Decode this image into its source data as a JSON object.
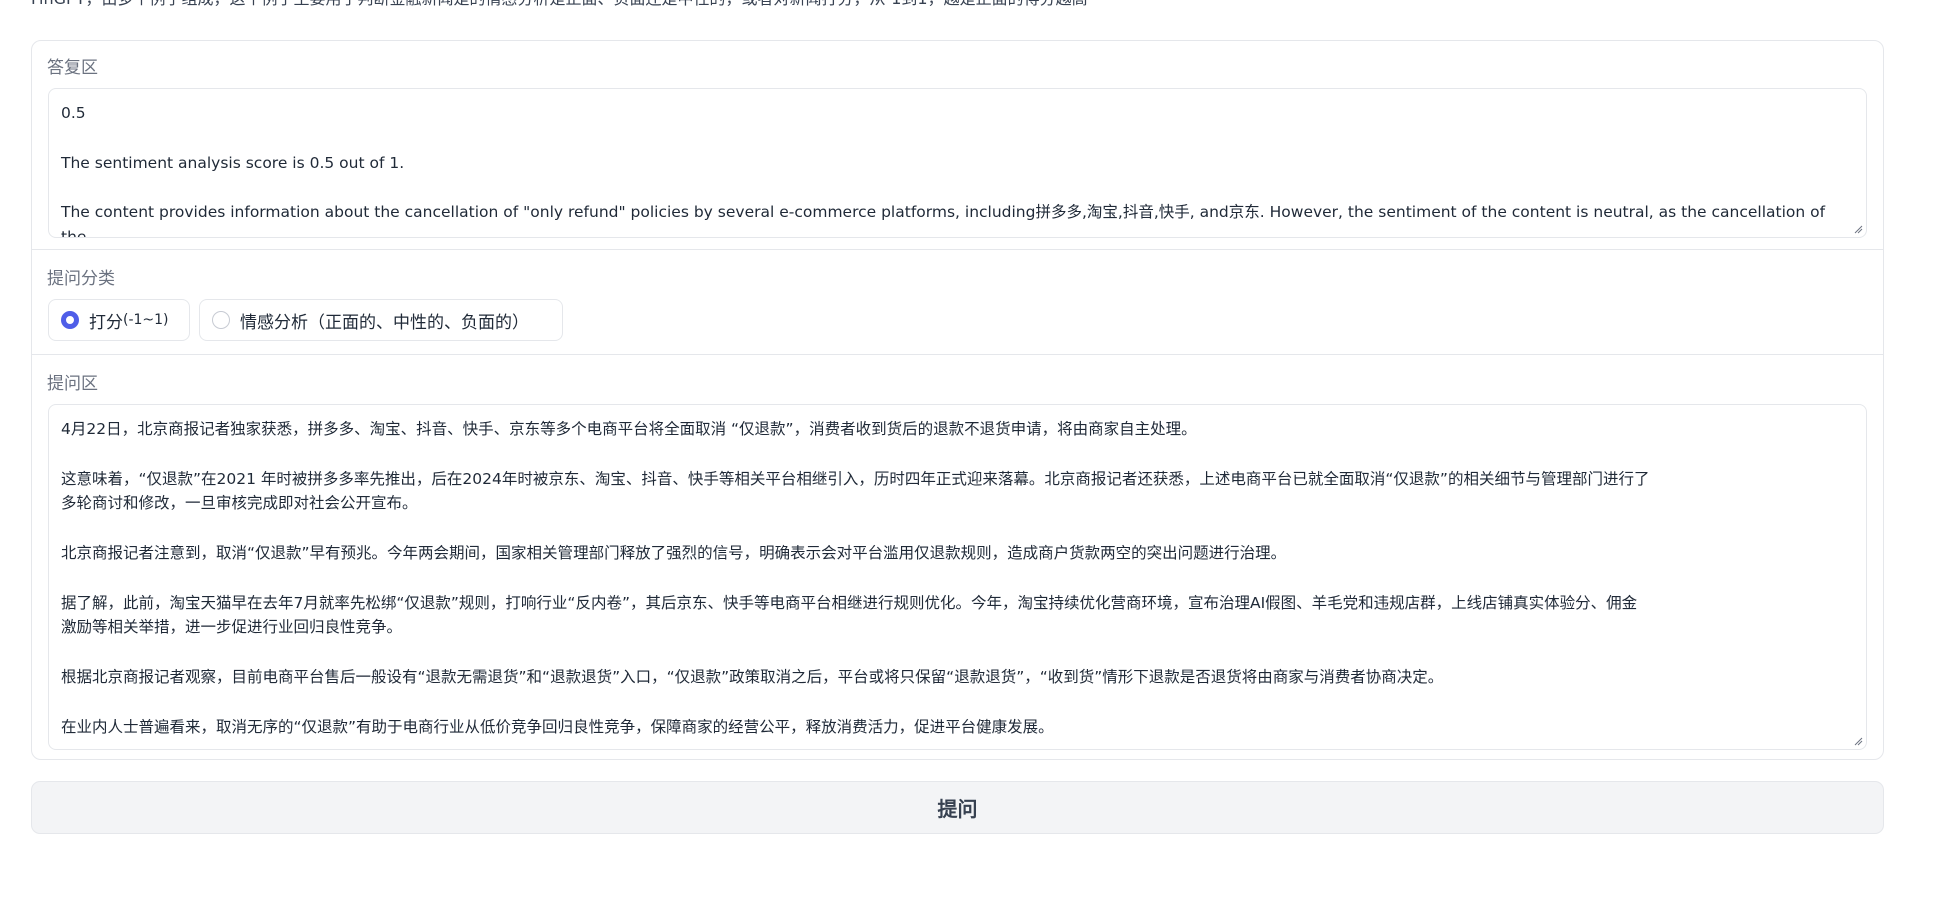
{
  "intro": "FinGPT，由多个例子组成，这个例子主要用于判断金融新闻是的情感分析是正面、负面还是中性的，或者对新闻打分，从-1到1，越是正面的得分越高",
  "answer": {
    "label": "答复区",
    "lines": [
      "0.5",
      "",
      "The sentiment analysis score is 0.5 out of 1.",
      "",
      "The content provides information about the cancellation of \"only refund\" policies by several e-commerce platforms, including拼多多,淘宝,抖音,快手, and京东. However, the sentiment of the content is neutral, as the cancellation of the"
    ]
  },
  "question_type": {
    "label": "提问分类",
    "options": [
      {
        "label": "打分",
        "suffix": "(-1~1)",
        "selected": true
      },
      {
        "label": "情感分析（正面的、中性的、负面的）",
        "suffix": "",
        "selected": false
      }
    ]
  },
  "question": {
    "label": "提问区",
    "lines": [
      "4月22日，北京商报记者独家获悉，拼多多、淘宝、抖音、快手、京东等多个电商平台将全面取消 “仅退款”，消费者收到货后的退款不退货申请，将由商家自主处理。",
      "",
      "这意味着，“仅退款”在2021 年时被拼多多率先推出，后在2024年时被京东、淘宝、抖音、快手等相关平台相继引入，历时四年正式迎来落幕。北京商报记者还获悉，上述电商平台已就全面取消“仅退款”的相关细节与管理部门进行了",
      "多轮商讨和修改，一旦审核完成即对社会公开宣布。",
      "",
      "北京商报记者注意到，取消“仅退款”早有预兆。今年两会期间，国家相关管理部门释放了强烈的信号，明确表示会对平台滥用仅退款规则，造成商户货款两空的突出问题进行治理。",
      "",
      "据了解，此前，淘宝天猫早在去年7月就率先松绑“仅退款”规则，打响行业“反内卷”，其后京东、快手等电商平台相继进行规则优化。今年，淘宝持续优化营商环境，宣布治理AI假图、羊毛党和违规店群，上线店铺真实体验分、佣金",
      "激励等相关举措，进一步促进行业回归良性竞争。",
      "",
      "根据北京商报记者观察，目前电商平台售后一般设有“退款无需退货”和“退款退货”入口，“仅退款”政策取消之后，平台或将只保留“退款退货”，“收到货”情形下退款是否退货将由商家与消费者协商决定。",
      "",
      "在业内人士普遍看来，取消无序的“仅退款”有助于电商行业从低价竞争回归良性竞争，保障商家的经营公平，释放消费活力，促进平台健康发展。"
    ]
  },
  "submit": {
    "label": "提问"
  }
}
